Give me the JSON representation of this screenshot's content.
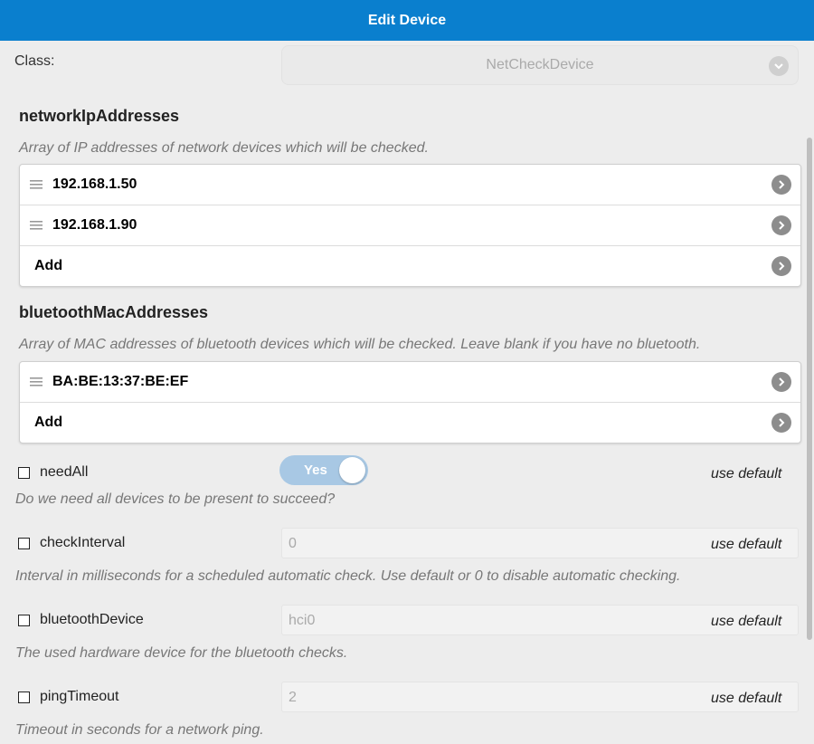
{
  "header": {
    "title": "Edit Device"
  },
  "class_field": {
    "label": "Class:",
    "value": "NetCheckDevice"
  },
  "network": {
    "title": "networkIpAddresses",
    "description": "Array of IP addresses of network devices which will be checked.",
    "items": [
      "192.168.1.50",
      "192.168.1.90"
    ],
    "add_label": "Add"
  },
  "bluetooth": {
    "title": "bluetoothMacAddresses",
    "description": "Array of MAC addresses of bluetooth devices which will be checked. Leave blank if you have no bluetooth.",
    "items": [
      "BA:BE:13:37:BE:EF"
    ],
    "add_label": "Add"
  },
  "options": {
    "needAll": {
      "label": "needAll",
      "toggle": "Yes",
      "default_label": "use default",
      "description": "Do we need all devices to be present to succeed?"
    },
    "checkInterval": {
      "label": "checkInterval",
      "value": "0",
      "default_label": "use default",
      "description": "Interval in milliseconds for a scheduled automatic check. Use default or 0 to disable automatic checking."
    },
    "bluetoothDevice": {
      "label": "bluetoothDevice",
      "value": "hci0",
      "default_label": "use default",
      "description": "The used hardware device for the bluetooth checks."
    },
    "pingTimeout": {
      "label": "pingTimeout",
      "value": "2",
      "default_label": "use default",
      "description": "Timeout in seconds for a network ping."
    }
  },
  "colors": {
    "header": "#0a7fce",
    "toggle": "#a8c8e4"
  },
  "icons": [
    "chevron-down-icon",
    "grip-icon",
    "chevron-right-icon"
  ]
}
